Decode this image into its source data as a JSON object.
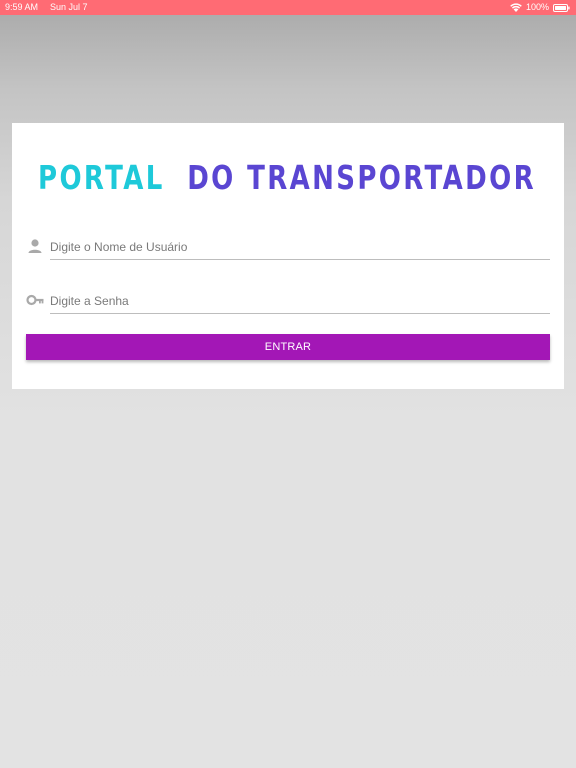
{
  "status_bar": {
    "time": "9:59 AM",
    "date": "Sun Jul 7",
    "battery": "100%",
    "wifi_icon": "wifi-icon",
    "battery_icon": "battery-full-icon",
    "color": "#ff6b74"
  },
  "logo": {
    "part1": "PORTAL",
    "part2": "DO TRANSPORTADOR",
    "part1_color": "#1ec9d9",
    "part2_color": "#5a46d2"
  },
  "form": {
    "username": {
      "placeholder": "Digite o Nome de Usuário",
      "icon": "person-icon"
    },
    "password": {
      "placeholder": "Digite a Senha",
      "icon": "key-icon"
    },
    "submit_label": "ENTRAR",
    "submit_color": "#a317b6"
  }
}
